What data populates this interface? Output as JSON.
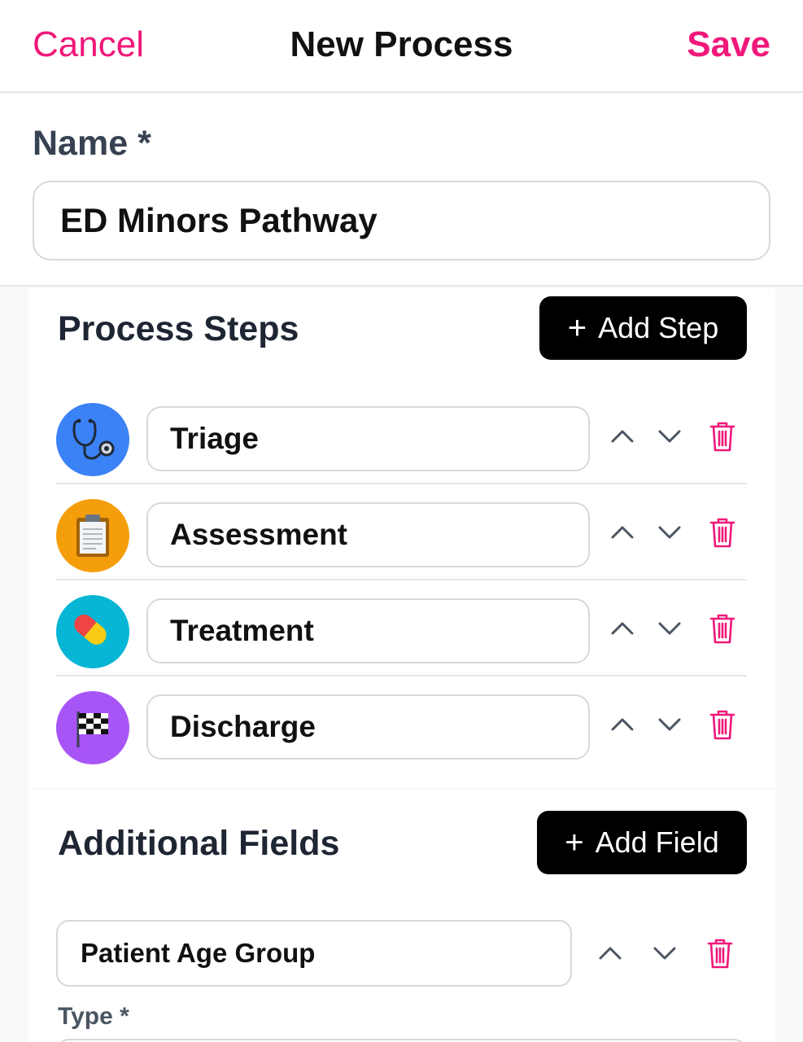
{
  "header": {
    "cancel_label": "Cancel",
    "title": "New Process",
    "save_label": "Save"
  },
  "name_field": {
    "label": "Name *",
    "value": "ED Minors Pathway"
  },
  "process_steps": {
    "title": "Process Steps",
    "add_label": "Add Step",
    "steps": [
      {
        "label": "Triage",
        "icon": "stethoscope-icon",
        "color": "#3b82f6"
      },
      {
        "label": "Assessment",
        "icon": "clipboard-icon",
        "color": "#f59e0b"
      },
      {
        "label": "Treatment",
        "icon": "pill-icon",
        "color": "#06b6d4"
      },
      {
        "label": "Discharge",
        "icon": "checkered-flag-icon",
        "color": "#a855f7"
      }
    ]
  },
  "additional_fields": {
    "title": "Additional Fields",
    "add_label": "Add Field",
    "fields": [
      {
        "label": "Patient Age Group",
        "type_label": "Type *"
      }
    ]
  },
  "colors": {
    "accent": "#f0187a",
    "button_bg": "#000000",
    "text_dark": "#111111",
    "chevron": "#6b7280"
  }
}
